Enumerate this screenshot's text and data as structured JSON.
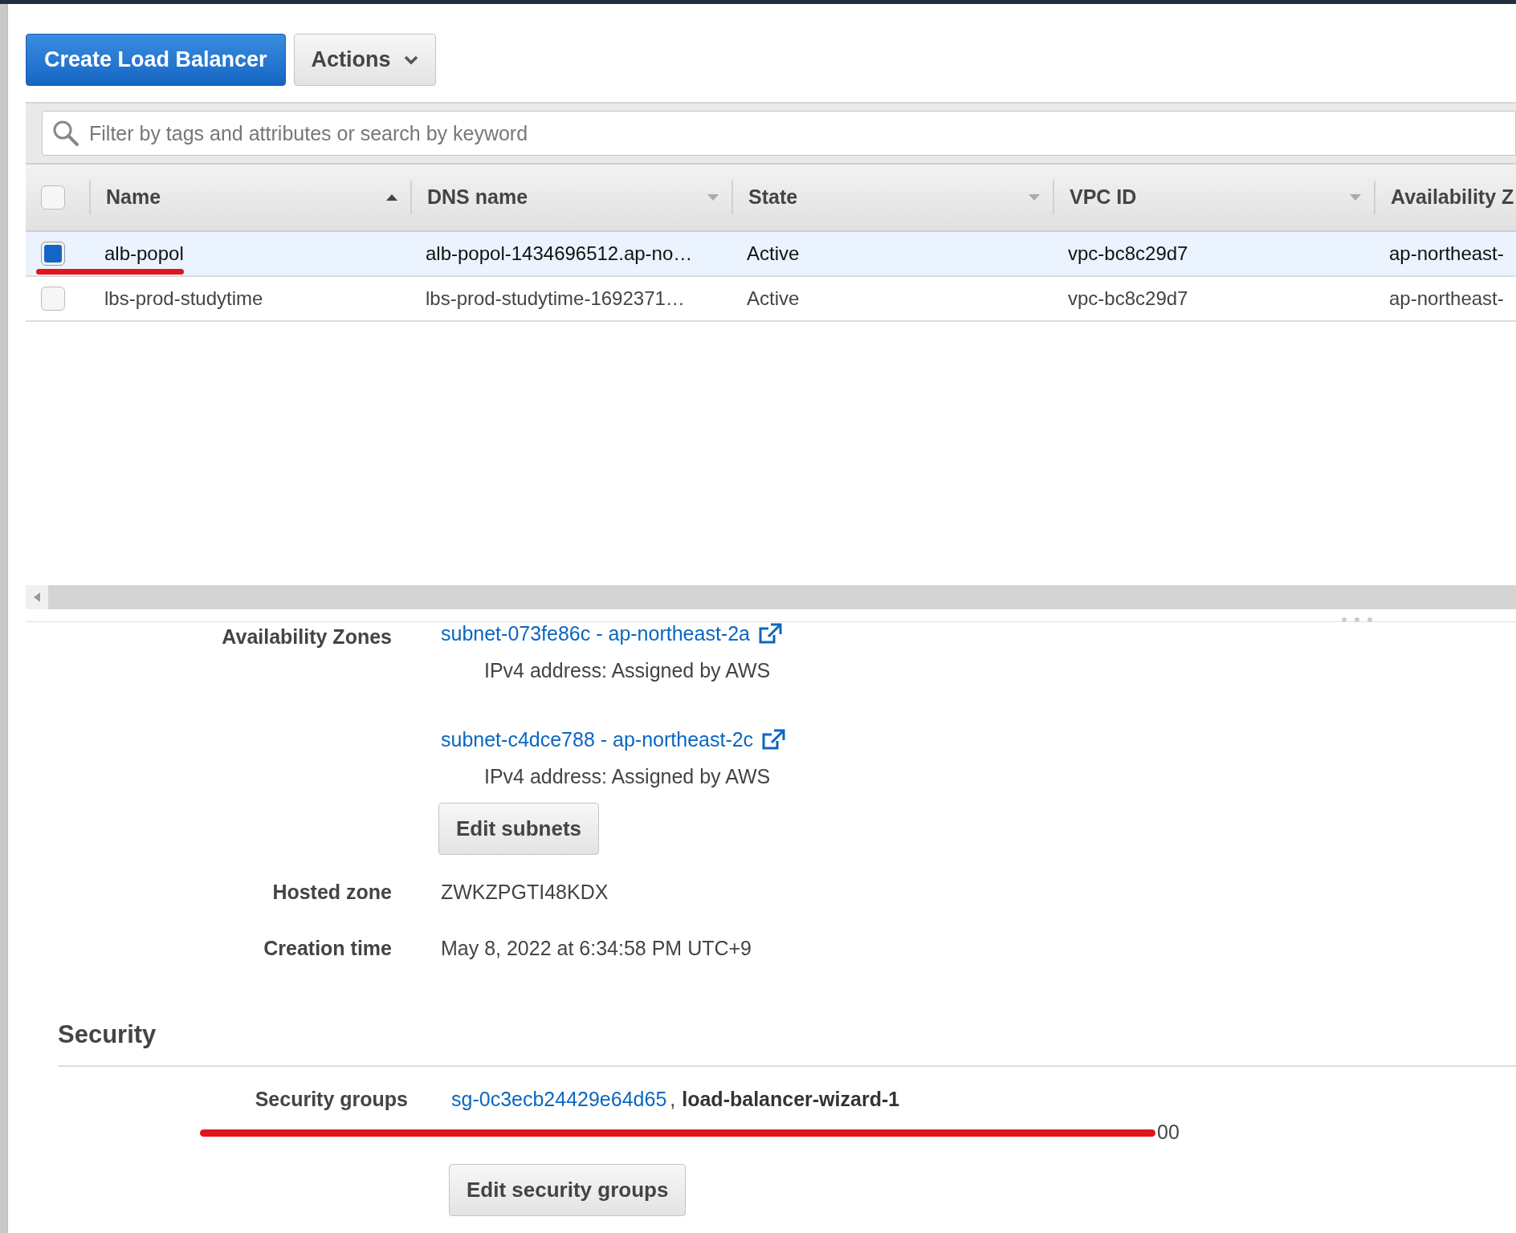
{
  "toolbar": {
    "buttons": [
      {
        "label": "Create Load Balancer",
        "kind": "primary"
      },
      {
        "label": "Actions",
        "kind": "dropdown"
      }
    ]
  },
  "search": {
    "placeholder": "Filter by tags and attributes or search by keyword"
  },
  "table": {
    "all_checked": false,
    "columns": [
      {
        "label": "Name",
        "sorted": true
      },
      {
        "label": "DNS name",
        "sorted": false
      },
      {
        "label": "State",
        "sorted": false
      },
      {
        "label": "VPC ID",
        "sorted": false
      },
      {
        "label": "Availability Z"
      }
    ],
    "rows": [
      {
        "selected": true,
        "underlined": true,
        "cells": [
          "alb-popol",
          "alb-popol-1434696512.ap-no…",
          "Active",
          "vpc-bc8c29d7",
          "ap-northeast-"
        ]
      },
      {
        "selected": false,
        "underlined": false,
        "cells": [
          "lbs-prod-studytime",
          "lbs-prod-studytime-1692371…",
          "Active",
          "vpc-bc8c29d7",
          "ap-northeast-"
        ]
      }
    ]
  },
  "details": {
    "availability_zones": {
      "label": "Availability Zones",
      "subnets": [
        {
          "link": "subnet-073fe86c - ap-northeast-2a",
          "note": "IPv4 address: Assigned by AWS"
        },
        {
          "link": "subnet-c4dce788 - ap-northeast-2c",
          "note": "IPv4 address: Assigned by AWS"
        }
      ],
      "button": "Edit subnets"
    },
    "fields": [
      {
        "label": "Hosted zone",
        "value": "ZWKZPGTI48KDX"
      },
      {
        "label": "Creation time",
        "value": "May 8, 2022 at 6:34:58 PM UTC+9"
      }
    ]
  },
  "security": {
    "heading": "Security",
    "label": "Security groups",
    "group_link": "sg-0c3ecb24429e64d65",
    "separator": ",",
    "group_name": "load-balancer-wizard-1",
    "description": "00",
    "struck": true,
    "button": "Edit security groups"
  }
}
